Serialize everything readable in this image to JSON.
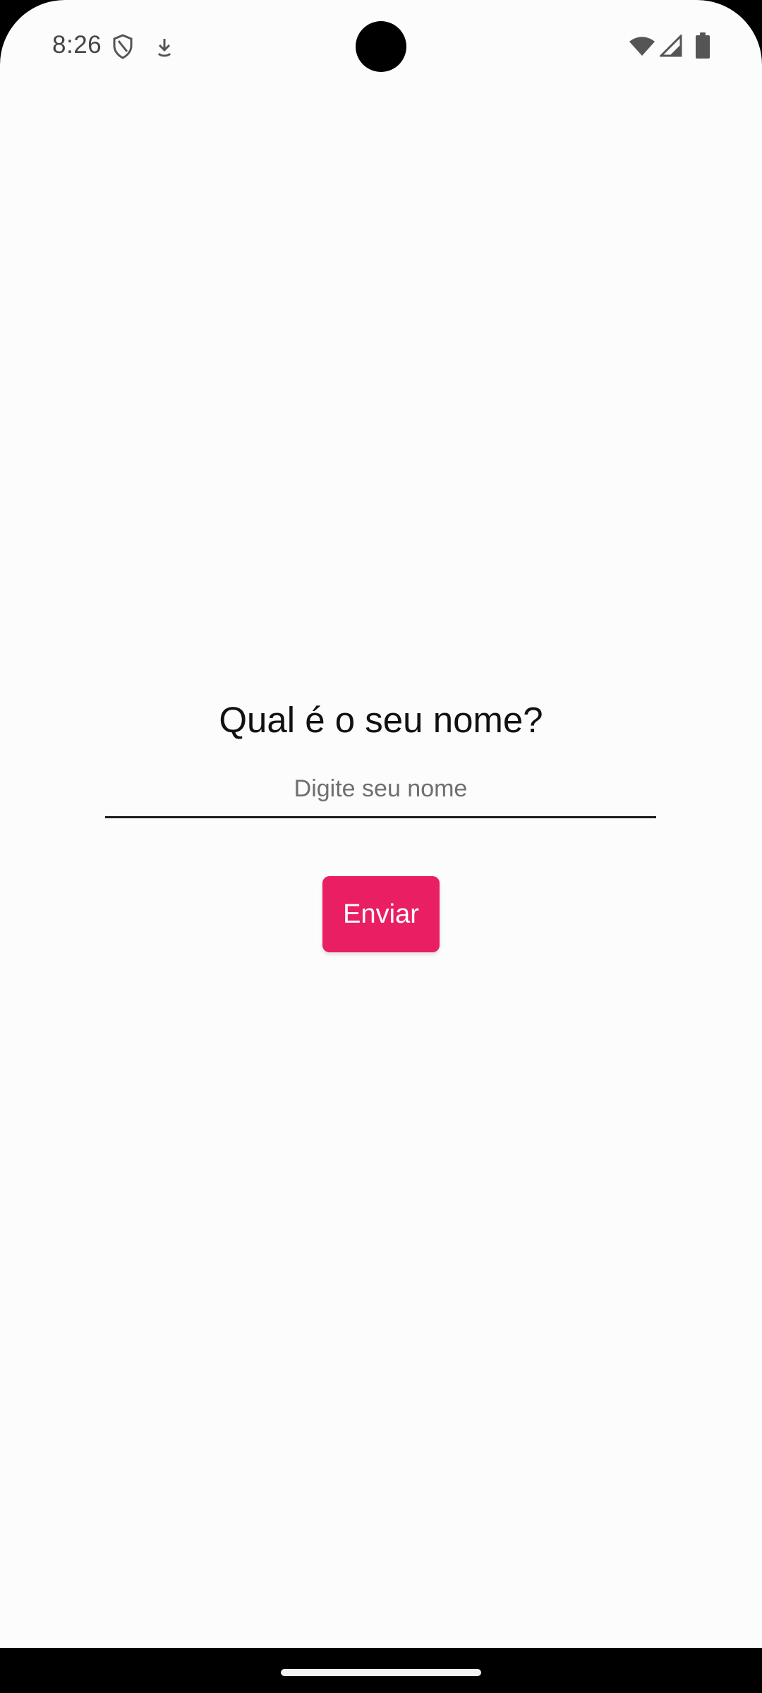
{
  "status_bar": {
    "time": "8:26",
    "icons": [
      "shield-icon",
      "download-icon",
      "wifi-icon",
      "cell-signal-icon",
      "battery-icon"
    ]
  },
  "form": {
    "question": "Qual é o seu nome?",
    "input_placeholder": "Digite seu nome",
    "input_value": "",
    "submit_label": "Enviar"
  },
  "colors": {
    "background": "#fcfcfc",
    "accent": "#e91e63",
    "text_primary": "#111111",
    "text_hint": "#6f6f6f"
  }
}
